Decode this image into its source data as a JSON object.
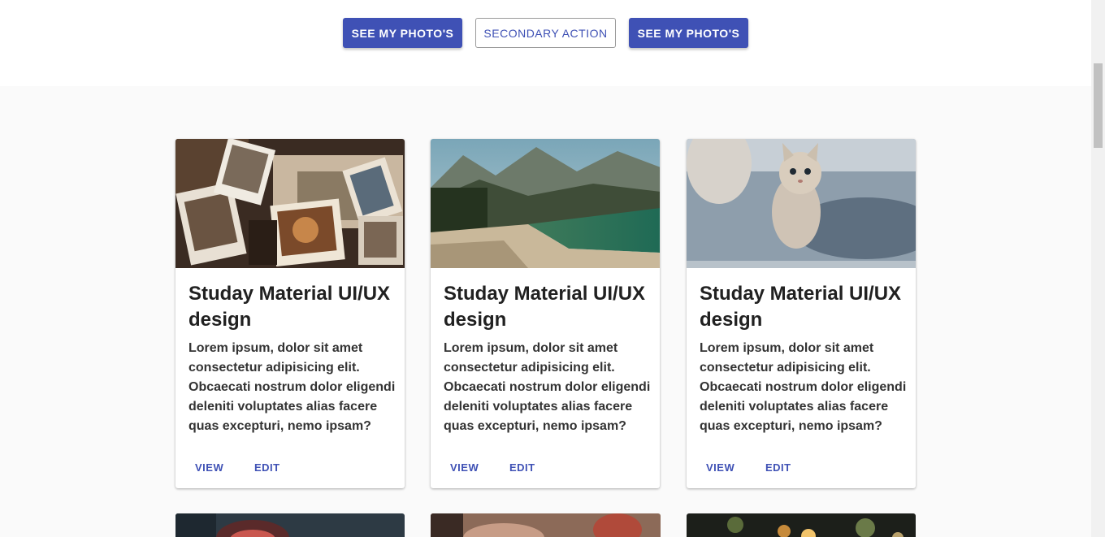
{
  "hero": {
    "buttons": [
      {
        "label": "SEE MY PHOTO'S",
        "style": "primary"
      },
      {
        "label": "SECONDARY ACTION",
        "style": "outline"
      },
      {
        "label": "SEE MY PHOTO'S",
        "style": "primary"
      }
    ]
  },
  "cards": [
    {
      "image": "scattered-photographs",
      "title": "Studay Material UI/UX design",
      "body": "Lorem ipsum, dolor sit amet consectetur adipisicing elit. Obcaecati nostrum dolor eligendi deleniti voluptates alias facere quas excepturi, nemo ipsam?",
      "actions": [
        "VIEW",
        "EDIT"
      ]
    },
    {
      "image": "mountain-lake-landscape",
      "title": "Studay Material UI/UX design",
      "body": "Lorem ipsum, dolor sit amet consectetur adipisicing elit. Obcaecati nostrum dolor eligendi deleniti voluptates alias facere quas excepturi, nemo ipsam?",
      "actions": [
        "VIEW",
        "EDIT"
      ]
    },
    {
      "image": "kitten-on-sofa",
      "title": "Studay Material UI/UX design",
      "body": "Lorem ipsum, dolor sit amet consectetur adipisicing elit. Obcaecati nostrum dolor eligendi deleniti voluptates alias facere quas excepturi, nemo ipsam?",
      "actions": [
        "VIEW",
        "EDIT"
      ]
    }
  ],
  "next_row_images": [
    "dog-open-mouth",
    "hands-close-up",
    "bokeh-lights"
  ],
  "colors": {
    "primary": "#3f51b5",
    "background": "#fafafa",
    "text": "#212121"
  }
}
